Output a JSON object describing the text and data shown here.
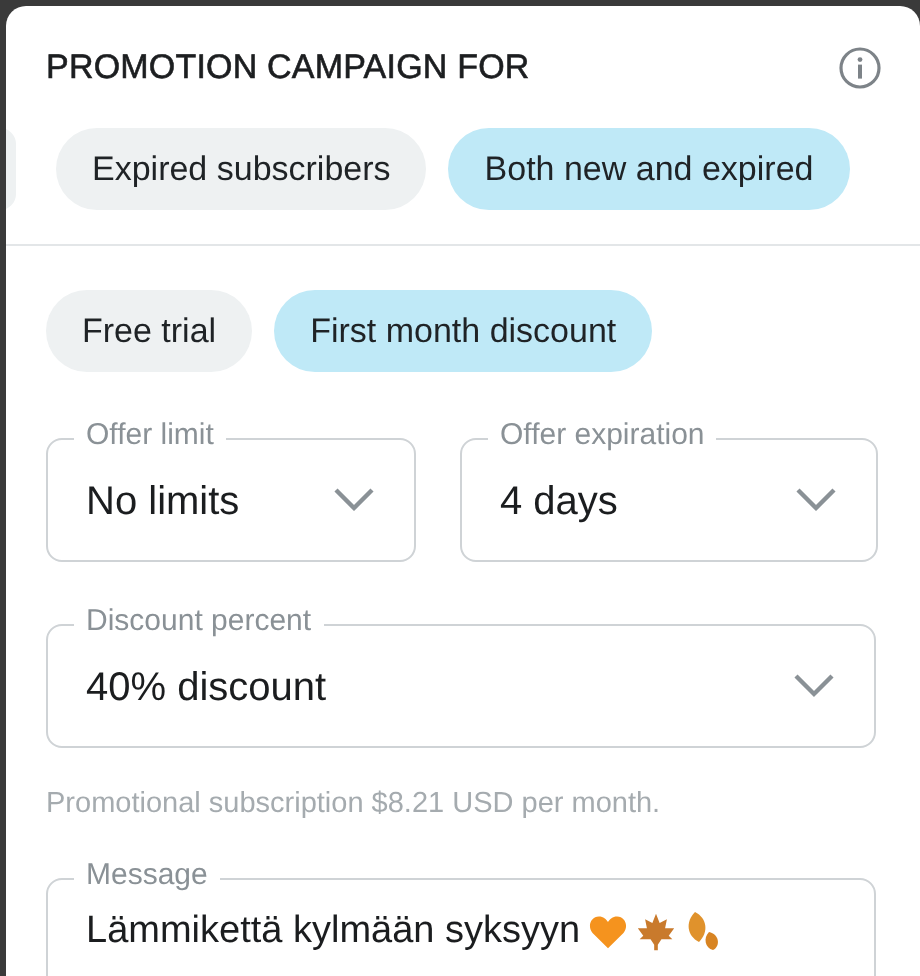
{
  "title": "PROMOTION CAMPAIGN FOR",
  "audience_chips": [
    {
      "label": "Expired subscribers",
      "selected": false
    },
    {
      "label": "Both new and expired",
      "selected": true
    }
  ],
  "offer_chips": [
    {
      "label": "Free trial",
      "selected": false
    },
    {
      "label": "First month discount",
      "selected": true
    }
  ],
  "fields": [
    {
      "label": "Offer limit",
      "value": "No limits"
    },
    {
      "label": "Offer expiration",
      "value": "4 days"
    },
    {
      "label": "Discount percent",
      "value": "40% discount"
    }
  ],
  "helper_text": "Promotional subscription $8.21 USD per month.",
  "message": {
    "label": "Message",
    "value": "Lämmikettä kylmään syksyyn"
  }
}
